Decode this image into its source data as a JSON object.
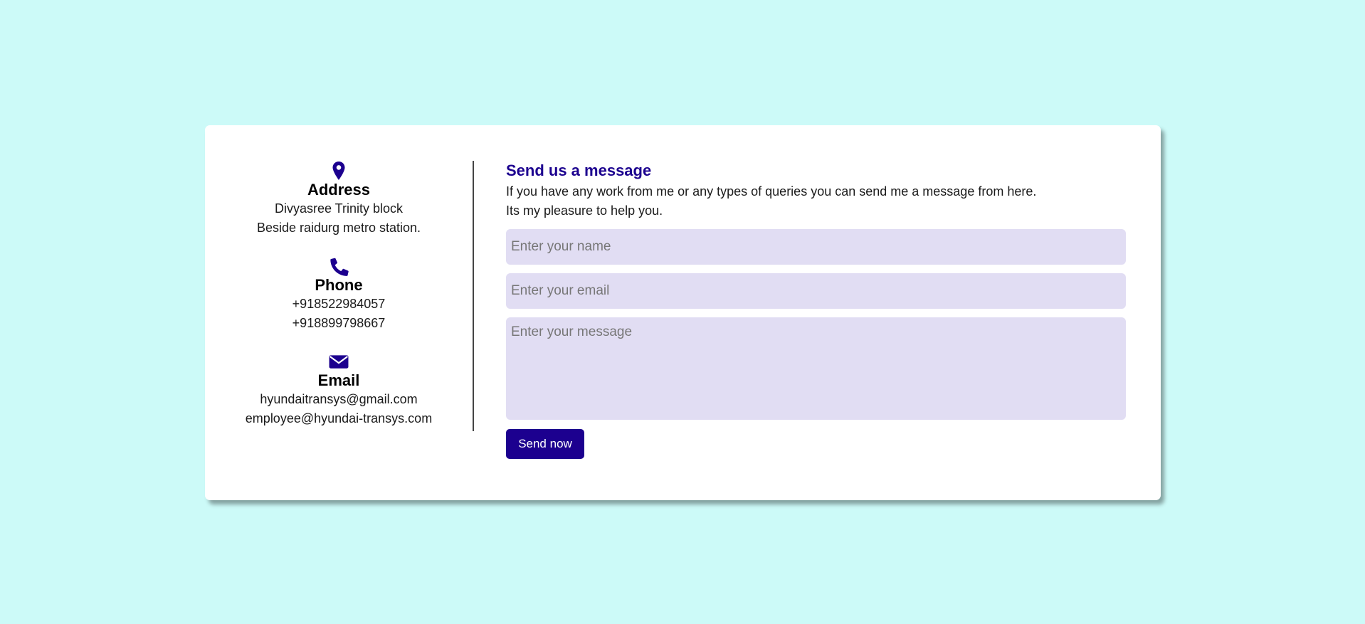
{
  "colors": {
    "background": "#ccfaf8",
    "accent": "#1c008f",
    "field_background": "#e1ddf3"
  },
  "contact": {
    "address": {
      "icon": "map-pin-icon",
      "title": "Address",
      "lines": [
        "Divyasree Trinity block",
        "Beside raidurg metro station."
      ]
    },
    "phone": {
      "icon": "phone-icon",
      "title": "Phone",
      "lines": [
        "+918522984057",
        "+918899798667"
      ]
    },
    "email": {
      "icon": "envelope-icon",
      "title": "Email",
      "lines": [
        "hyundaitransys@gmail.com",
        "employee@hyundai-transys.com"
      ]
    }
  },
  "form": {
    "title": "Send us a message",
    "description_lines": [
      "If you have any work from me or any types of queries you can send me a message from here.",
      "Its my pleasure to help you."
    ],
    "name_placeholder": "Enter your name",
    "email_placeholder": "Enter your email",
    "message_placeholder": "Enter your message",
    "submit_label": "Send now"
  }
}
